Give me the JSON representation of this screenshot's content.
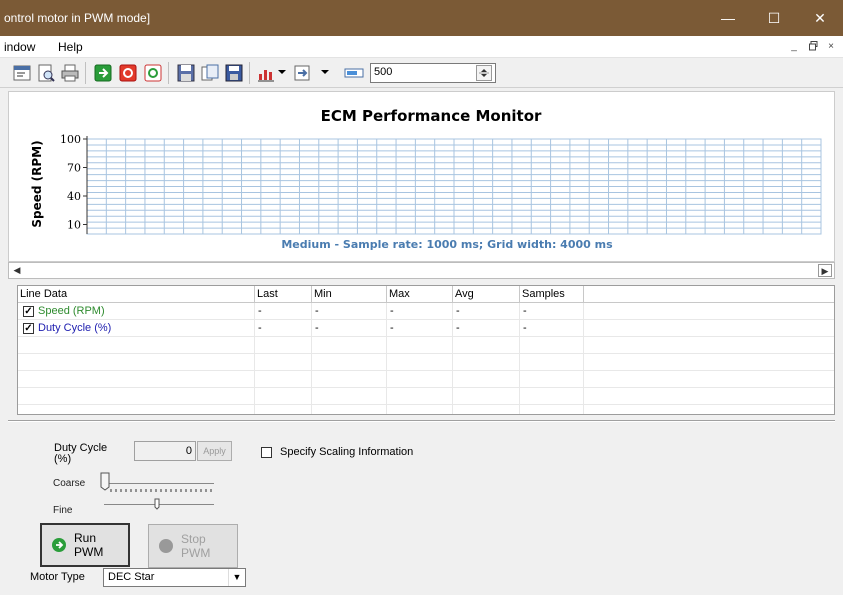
{
  "window": {
    "title": "ontrol motor in PWM mode]",
    "titlebar_color": "#7b5a36",
    "minimize_glyph": "—",
    "maximize_glyph": "☐",
    "close_glyph": "✕"
  },
  "menu": {
    "items": [
      "indow",
      "Help"
    ],
    "mdi_minimize": "_",
    "mdi_restore": "̅",
    "mdi_close": "×"
  },
  "toolbar": {
    "icons": [
      "properties-icon",
      "print-preview-icon",
      "print-icon",
      "start-icon",
      "stop-icon",
      "capture-icon",
      "save-icon",
      "copy-icon",
      "save-disk-icon",
      "chart-type-icon",
      "export-icon",
      "zoom-bar-icon"
    ],
    "sample_count_value": "500"
  },
  "chart": {
    "title": "ECM Performance Monitor",
    "footer": "Medium - Sample rate: 1000 ms; Grid width:  4000 ms",
    "footer_color": "#4a7cb0"
  },
  "chart_data": {
    "type": "line",
    "title": "ECM Performance Monitor",
    "xlabel": "",
    "ylabel": "Speed (RPM)",
    "y_ticks": [
      100,
      70,
      40,
      10
    ],
    "ylim": [
      0,
      100
    ],
    "grid": true,
    "series": []
  },
  "table": {
    "columns": [
      "Line Data",
      "Last",
      "Min",
      "Max",
      "Avg",
      "Samples"
    ],
    "rows": [
      {
        "label": "Speed (RPM)",
        "checked": "✓",
        "color": "#2e8b2e",
        "last": "-",
        "min": "-",
        "max": "-",
        "avg": "-",
        "samples": "-"
      },
      {
        "label": "Duty Cycle (%)",
        "checked": "✓",
        "color": "#2020b0",
        "last": "-",
        "min": "-",
        "max": "-",
        "avg": "-",
        "samples": "-"
      }
    ]
  },
  "controls": {
    "duty_cycle_label": "Duty Cycle",
    "duty_cycle_unit": "(%)",
    "duty_cycle_value": "0",
    "apply_label": "Apply",
    "scaling_label": "Specify Scaling Information",
    "coarse_label": "Coarse",
    "fine_label": "Fine",
    "run_label": "Run PWM",
    "stop_label": "Stop PWM",
    "motor_type_label": "Motor Type",
    "motor_type_value": "DEC Star"
  }
}
